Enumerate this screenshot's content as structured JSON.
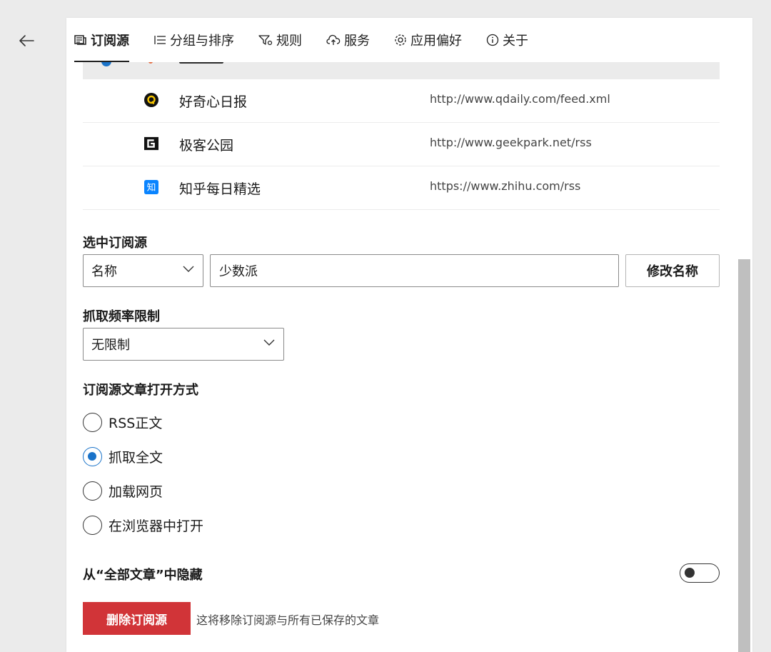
{
  "nav": {
    "back_icon": "arrow-left-icon",
    "tabs": [
      {
        "label": "订阅源",
        "icon": "feed-icon",
        "active": true
      },
      {
        "label": "分组与排序",
        "icon": "list-icon",
        "active": false
      },
      {
        "label": "规则",
        "icon": "filter-icon",
        "active": false
      },
      {
        "label": "服务",
        "icon": "cloud-icon",
        "active": false
      },
      {
        "label": "应用偏好",
        "icon": "gear-icon",
        "active": false
      },
      {
        "label": "关于",
        "icon": "info-icon",
        "active": false
      }
    ]
  },
  "feeds": [
    {
      "name": "好奇心日报",
      "url": "http://www.qdaily.com/feed.xml",
      "icon": "qdaily-icon"
    },
    {
      "name": "极客公园",
      "url": "http://www.geekpark.net/rss",
      "icon": "geekpark-icon"
    },
    {
      "name": "知乎每日精选",
      "url": "https://www.zhihu.com/rss",
      "icon": "zhihu-icon"
    }
  ],
  "selected": {
    "title": "选中订阅源",
    "field_select": "名称",
    "field_value": "少数派",
    "rename_button": "修改名称"
  },
  "frequency": {
    "title": "抓取频率限制",
    "value": "无限制"
  },
  "open_mode": {
    "title": "订阅源文章打开方式",
    "options": [
      {
        "label": "RSS正文",
        "checked": false
      },
      {
        "label": "抓取全文",
        "checked": true
      },
      {
        "label": "加载网页",
        "checked": false
      },
      {
        "label": "在浏览器中打开",
        "checked": false
      }
    ]
  },
  "hide": {
    "title": "从“全部文章”中隐藏",
    "enabled": false
  },
  "delete": {
    "button": "删除订阅源",
    "hint": "这将移除订阅源与所有已保存的文章"
  },
  "colors": {
    "accent": "#1a73c9",
    "danger": "#d13438",
    "background": "#ebebeb"
  }
}
